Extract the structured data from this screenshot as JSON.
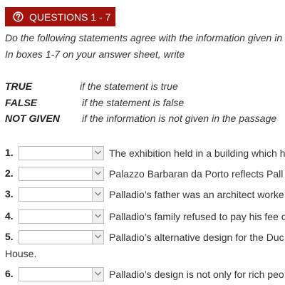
{
  "header": {
    "icon": "question-circle-icon",
    "title": "QUESTIONS 1 - 7",
    "bg_color": "#a4120c"
  },
  "instructions": {
    "line1": "Do the following statements agree with the information given in",
    "line2": "In boxes 1-7 on your answer sheet, write"
  },
  "legend": [
    {
      "key": "TRUE",
      "desc": "if the statement is true"
    },
    {
      "key": "FALSE",
      "desc": "if the statement is false"
    },
    {
      "key": "NOT GIVEN",
      "desc": "if the information is not given in the passage"
    }
  ],
  "questions": [
    {
      "number": "1.",
      "selected": "",
      "text": "The exhibition held in a building which h"
    },
    {
      "number": "2.",
      "selected": "",
      "text": "Palazzo Barbaran da Porto reflects Pall"
    },
    {
      "number": "3.",
      "selected": "",
      "text": "Palladio’s father was an architect worke"
    },
    {
      "number": "4.",
      "selected": "",
      "text": "Palladio’s family refused to pay his fee o"
    },
    {
      "number": "5.",
      "selected": "",
      "text": "Palladio’s alternative design for the Duc",
      "continuation": "House."
    },
    {
      "number": "6.",
      "selected": "",
      "text": "Palladio’s design is not only for rich peo"
    }
  ]
}
